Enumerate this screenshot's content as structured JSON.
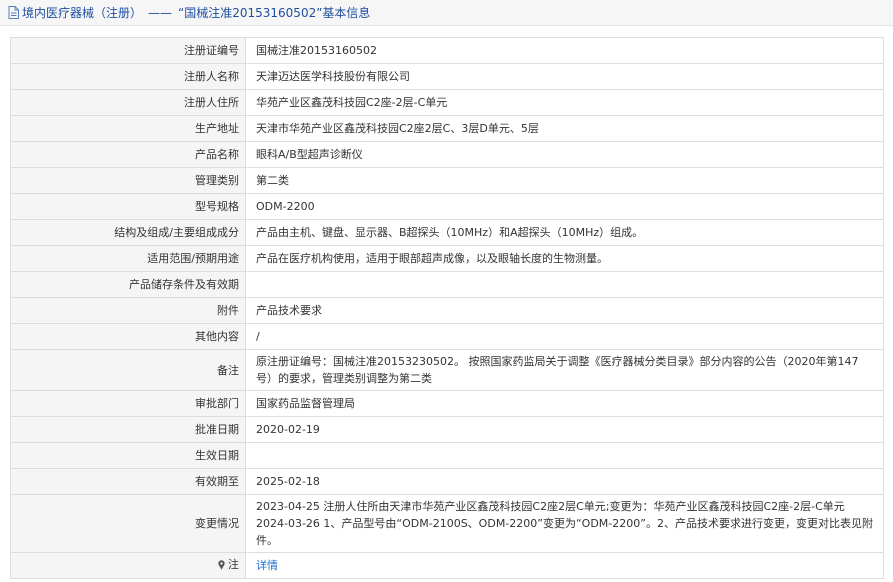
{
  "header": {
    "section": "境内医疗器械（注册）",
    "separator": "——",
    "title": "“国械注准20153160502”基本信息",
    "icon": "document-icon"
  },
  "rows": [
    {
      "label": "注册证编号",
      "value": "国械注准20153160502"
    },
    {
      "label": "注册人名称",
      "value": "天津迈达医学科技股份有限公司"
    },
    {
      "label": "注册人住所",
      "value": "华苑产业区鑫茂科技园C2座-2层-C单元"
    },
    {
      "label": "生产地址",
      "value": "天津市华苑产业区鑫茂科技园C2座2层C、3层D单元、5层"
    },
    {
      "label": "产品名称",
      "value": "眼科A/B型超声诊断仪"
    },
    {
      "label": "管理类别",
      "value": "第二类"
    },
    {
      "label": "型号规格",
      "value": "ODM-2200"
    },
    {
      "label": "结构及组成/主要组成成分",
      "value": "产品由主机、键盘、显示器、B超探头（10MHz）和A超探头（10MHz）组成。"
    },
    {
      "label": "适用范围/预期用途",
      "value": "产品在医疗机构使用，适用于眼部超声成像，以及眼轴长度的生物测量。"
    },
    {
      "label": "产品储存条件及有效期",
      "value": ""
    },
    {
      "label": "附件",
      "value": "产品技术要求"
    },
    {
      "label": "其他内容",
      "value": "/"
    },
    {
      "label": "备注",
      "value": "原注册证编号：国械注准20153230502。 按照国家药监局关于调整《医疗器械分类目录》部分内容的公告（2020年第147号）的要求，管理类别调整为第二类"
    },
    {
      "label": "审批部门",
      "value": "国家药品监督管理局"
    },
    {
      "label": "批准日期",
      "value": "2020-02-19"
    },
    {
      "label": "生效日期",
      "value": ""
    },
    {
      "label": "有效期至",
      "value": "2025-02-18"
    },
    {
      "label": "变更情况",
      "value_lines": [
        "2023-04-25 注册人住所由天津市华苑产业区鑫茂科技园C2座2层C单元;变更为：华苑产业区鑫茂科技园C2座-2层-C单元",
        "2024-03-26 1、产品型号由“ODM-2100S、ODM-2200”变更为“ODM-2200”。2、产品技术要求进行变更，变更对比表见附件。"
      ]
    }
  ],
  "note": {
    "label": "注",
    "link_text": "详情",
    "icon": "pin-icon"
  }
}
